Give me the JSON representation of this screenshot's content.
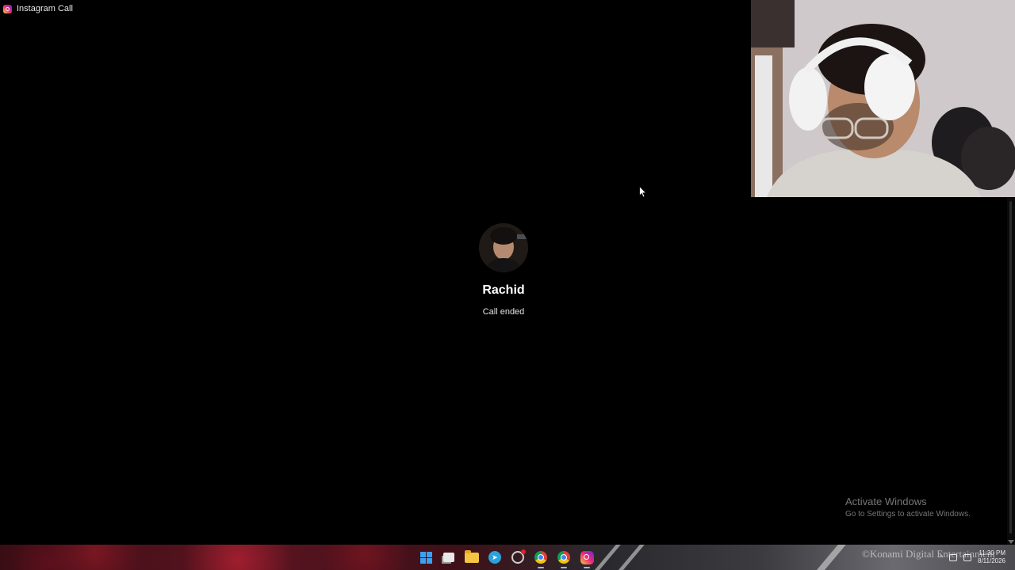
{
  "window": {
    "title": "Instagram Call",
    "app_icon": "instagram-icon"
  },
  "call": {
    "caller_name": "Rachid",
    "status": "Call ended"
  },
  "watermark": {
    "title": "Activate Windows",
    "subtitle": "Go to Settings to activate Windows."
  },
  "taskbar": {
    "apps": [
      {
        "name": "start",
        "icon": "windows-start-icon"
      },
      {
        "name": "task-view",
        "icon": "task-view-icon"
      },
      {
        "name": "file-explorer",
        "icon": "folder-icon"
      },
      {
        "name": "telegram",
        "icon": "telegram-icon"
      },
      {
        "name": "app-with-notification",
        "icon": "app-icon"
      },
      {
        "name": "chrome",
        "icon": "chrome-icon"
      },
      {
        "name": "chrome-2",
        "icon": "chrome-icon"
      },
      {
        "name": "instagram",
        "icon": "instagram-icon"
      }
    ],
    "overlay_text": "©Konami Digital Entertainment",
    "clock_time": "11:30 PM",
    "clock_date": "8/11/2026"
  },
  "colors": {
    "background": "#000000",
    "accent": "#3aa0f2"
  }
}
